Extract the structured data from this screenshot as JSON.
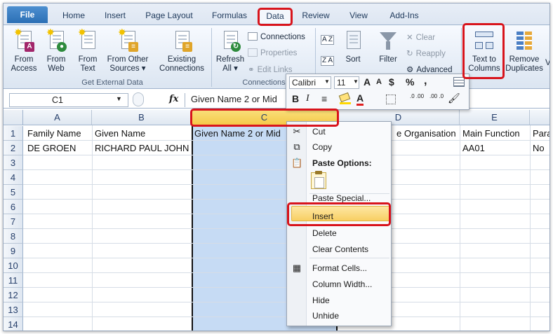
{
  "tabs": [
    {
      "label": "File"
    },
    {
      "label": "Home"
    },
    {
      "label": "Insert"
    },
    {
      "label": "Page Layout"
    },
    {
      "label": "Formulas"
    },
    {
      "label": "Data"
    },
    {
      "label": "Review"
    },
    {
      "label": "View"
    },
    {
      "label": "Add-Ins"
    }
  ],
  "ribbon": {
    "get_external": {
      "from_access": "From\nAccess",
      "from_web": "From\nWeb",
      "from_text": "From\nText",
      "from_other": "From Other\nSources ▾",
      "existing": "Existing\nConnections",
      "group": "Get External Data"
    },
    "connections": {
      "refresh": "Refresh\nAll ▾",
      "connections": "Connections",
      "properties": "Properties",
      "edit_links": "Edit Links",
      "group": "Connections"
    },
    "sort": {
      "sort": "Sort",
      "filter": "Filter",
      "clear": "Clear",
      "reapply": "Reapply",
      "advanced": "Advanced"
    },
    "tools": {
      "text_to_columns": "Text to\nColumns",
      "remove_duplicates": "Remove\nDuplicates",
      "overflow": "V"
    },
    "icon_letters": {
      "access": "A",
      "az": "A Z",
      "za": "Z A"
    }
  },
  "formula_bar": {
    "name_box": "C1",
    "fx": "fx",
    "formula": "Given Name 2 or Mid"
  },
  "grid": {
    "columns": [
      "A",
      "B",
      "C",
      "D",
      "E"
    ],
    "rows": [
      "1",
      "2",
      "3",
      "4",
      "5",
      "6",
      "7",
      "8",
      "9",
      "10",
      "11",
      "12",
      "13",
      "14"
    ],
    "cells": {
      "A1": "Family Name",
      "B1": "Given Name",
      "C1": "Given Name 2 or Mid",
      "D1": "e Organisation",
      "E1": "Main Function",
      "F1": "Para",
      "A2": "DE GROEN",
      "B2": "RICHARD PAUL JOHN",
      "E2": "AA01",
      "F2": "No"
    }
  },
  "mini_toolbar": {
    "font": "Calibri",
    "size": "11",
    "grow": "A",
    "shrink": "A",
    "currency": "$",
    "percent": "%",
    "comma": ",",
    "bold": "B",
    "italic": "I",
    "font_color": "A",
    "inc_decimal": ".0 .00",
    "dec_decimal": ".00 .0"
  },
  "context_menu": {
    "cut": "Cut",
    "copy": "Copy",
    "paste_options": "Paste Options:",
    "paste_special": "Paste Special...",
    "insert": "Insert",
    "delete": "Delete",
    "clear_contents": "Clear Contents",
    "format_cells": "Format Cells...",
    "column_width": "Column Width...",
    "hide": "Hide",
    "unhide": "Unhide"
  },
  "colors": {
    "accent_red": "#d8141c",
    "selection": "#c6dbf4",
    "header_selected": "#f5c94a",
    "file_tab": "#2b6fb5"
  }
}
